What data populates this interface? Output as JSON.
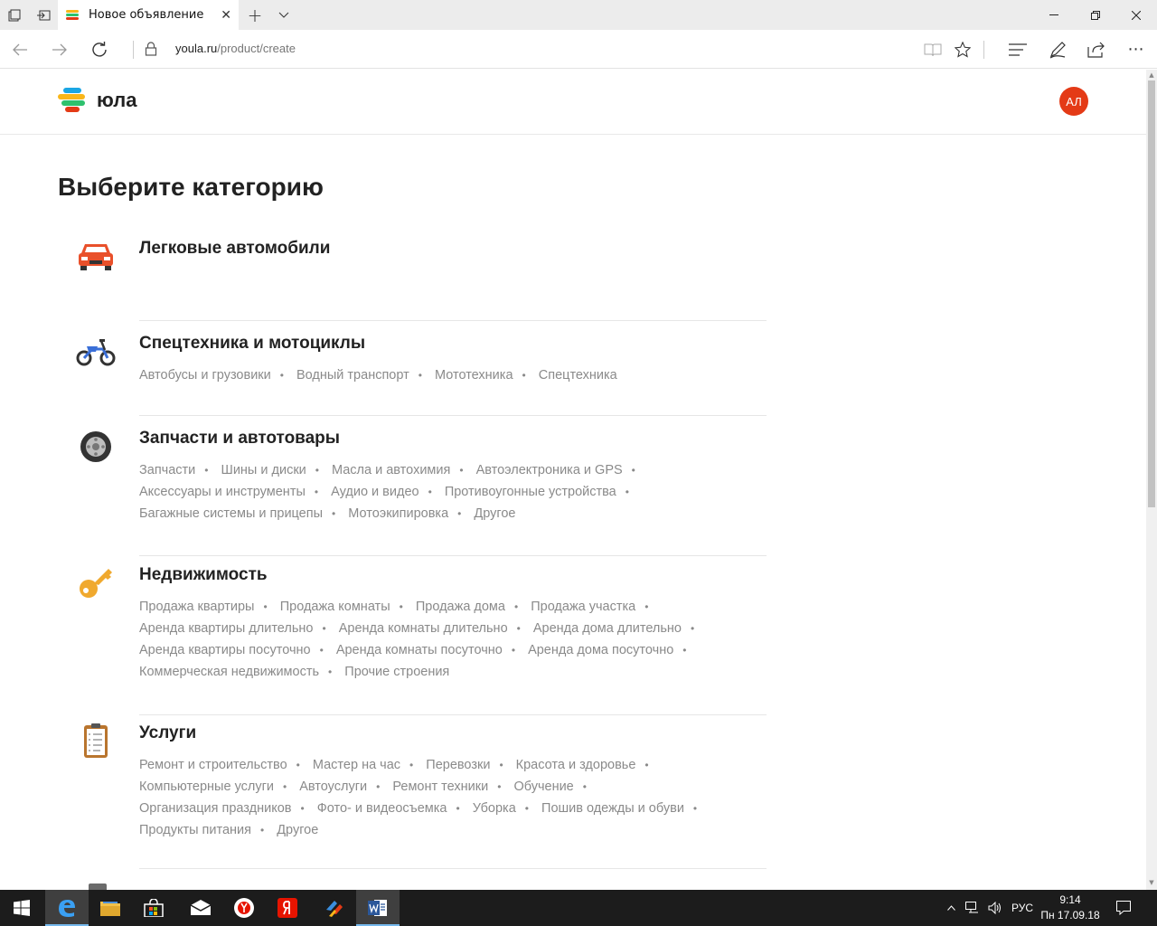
{
  "browser": {
    "tab_title": "Новое объявление",
    "url_domain": "youla.ru",
    "url_path": "/product/create"
  },
  "site": {
    "logo_text": "юла",
    "avatar_initials": "АЛ"
  },
  "page": {
    "title": "Выберите категорию"
  },
  "categories": [
    {
      "name": "Легковые автомобили",
      "icon": "car-icon",
      "subcategories": []
    },
    {
      "name": "Спецтехника и мотоциклы",
      "icon": "motorcycle-icon",
      "subcategories": [
        "Автобусы и грузовики",
        "Водный транспорт",
        "Мототехника",
        "Спецтехника"
      ]
    },
    {
      "name": "Запчасти и автотовары",
      "icon": "wheel-icon",
      "subcategories": [
        "Запчасти",
        "Шины и диски",
        "Масла и автохимия",
        "Автоэлектроника и GPS",
        "Аксессуары и инструменты",
        "Аудио и видео",
        "Противоугонные устройства",
        "Багажные системы и прицепы",
        "Мотоэкипировка",
        "Другое"
      ]
    },
    {
      "name": "Недвижимость",
      "icon": "key-icon",
      "subcategories": [
        "Продажа квартиры",
        "Продажа комнаты",
        "Продажа дома",
        "Продажа участка",
        "Аренда квартиры длительно",
        "Аренда комнаты длительно",
        "Аренда дома длительно",
        "Аренда квартиры посуточно",
        "Аренда комнаты посуточно",
        "Аренда дома посуточно",
        "Коммерческая недвижимость",
        "Прочие строения"
      ]
    },
    {
      "name": "Услуги",
      "icon": "clipboard-icon",
      "subcategories": [
        "Ремонт и строительство",
        "Мастер на час",
        "Перевозки",
        "Красота и здоровье",
        "Компьютерные услуги",
        "Автоуслуги",
        "Ремонт техники",
        "Обучение",
        "Организация праздников",
        "Фото- и видеосъемка",
        "Уборка",
        "Пошив одежды и обуви",
        "Продукты питания",
        "Другое"
      ]
    }
  ],
  "taskbar": {
    "language": "РУС",
    "time": "9:14",
    "date": "Пн 17.09.18"
  },
  "colors": {
    "avatar": "#e43a16",
    "subcategory_text": "#8a8a8a",
    "heading_text": "#222222",
    "taskbar": "#1c1c1c"
  }
}
